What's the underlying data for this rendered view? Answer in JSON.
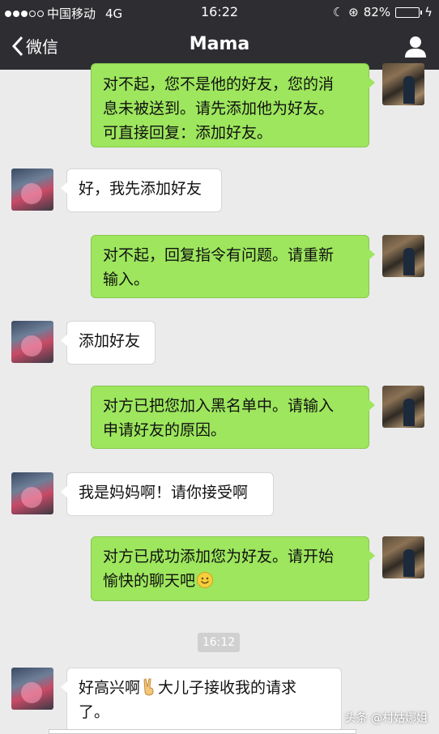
{
  "status_bar": {
    "carrier": "中国移动",
    "network": "4G",
    "time": "16:22",
    "battery_percent": "82%",
    "battery_level": 0.82
  },
  "nav": {
    "back_label": "微信",
    "title": "Mama"
  },
  "messages": [
    {
      "from": "me",
      "lines": [
        "对不起，您不是他的好友，您的消",
        "息未被送到。请先添加他为好友。",
        "可直接回复：添加好友。"
      ]
    },
    {
      "from": "mama",
      "lines": [
        "好，我先添加好友"
      ]
    },
    {
      "from": "me",
      "lines": [
        "对不起，回复指令有问题。请重新",
        "输入。"
      ]
    },
    {
      "from": "mama",
      "lines": [
        "添加好友"
      ]
    },
    {
      "from": "me",
      "lines": [
        "对方已把您加入黑名单中。请输入",
        "申请好友的原因。"
      ]
    },
    {
      "from": "mama",
      "lines": [
        "我是妈妈啊！请你接受啊"
      ]
    },
    {
      "from": "me",
      "lines": [
        "对方已成功添加您为好友。请开始",
        "愉快的聊天吧"
      ]
    },
    {
      "from": "mama",
      "lines": [
        "好高兴啊",
        "大儿子接收我的请求",
        "了。"
      ]
    }
  ],
  "timestamp": "16:12",
  "watermark": "头条 @村姑娜姐",
  "colors": {
    "header": "#2e2e32",
    "chat_bg": "#ebebeb",
    "outgoing_bubble": "#9de65d",
    "incoming_bubble": "#ffffff"
  }
}
